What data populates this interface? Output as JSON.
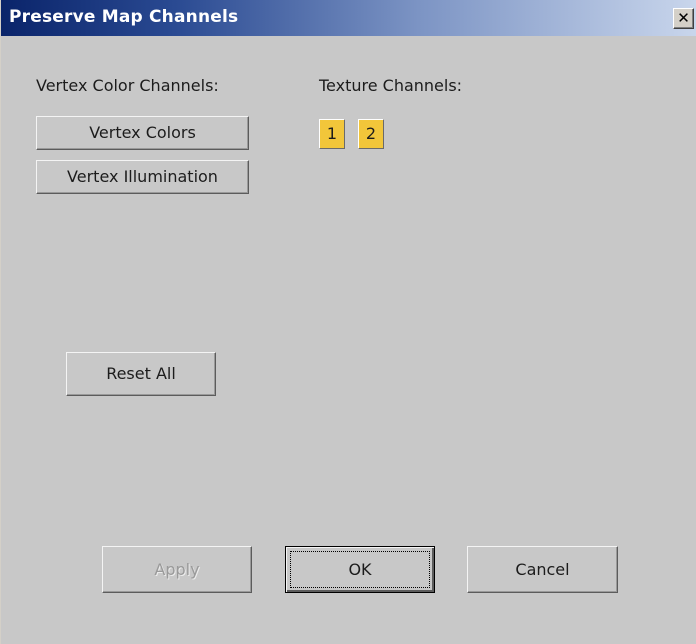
{
  "window": {
    "title": "Preserve Map Channels",
    "close_glyph": "✕"
  },
  "vertex_color_section": {
    "heading": "Vertex Color Channels:",
    "buttons": [
      {
        "label": "Vertex Colors"
      },
      {
        "label": "Vertex Illumination"
      }
    ]
  },
  "texture_section": {
    "heading": "Texture Channels:",
    "channels": [
      {
        "label": "1",
        "selected": true
      },
      {
        "label": "2",
        "selected": true
      }
    ],
    "selected_color": "#f2c63a"
  },
  "reset_all_label": "Reset All",
  "footer": {
    "apply_label": "Apply",
    "apply_enabled": false,
    "ok_label": "OK",
    "cancel_label": "Cancel"
  },
  "colors": {
    "dialog_bg": "#c8c8c8",
    "titlebar_start": "#0a246a",
    "titlebar_end": "#c9d6ec"
  }
}
